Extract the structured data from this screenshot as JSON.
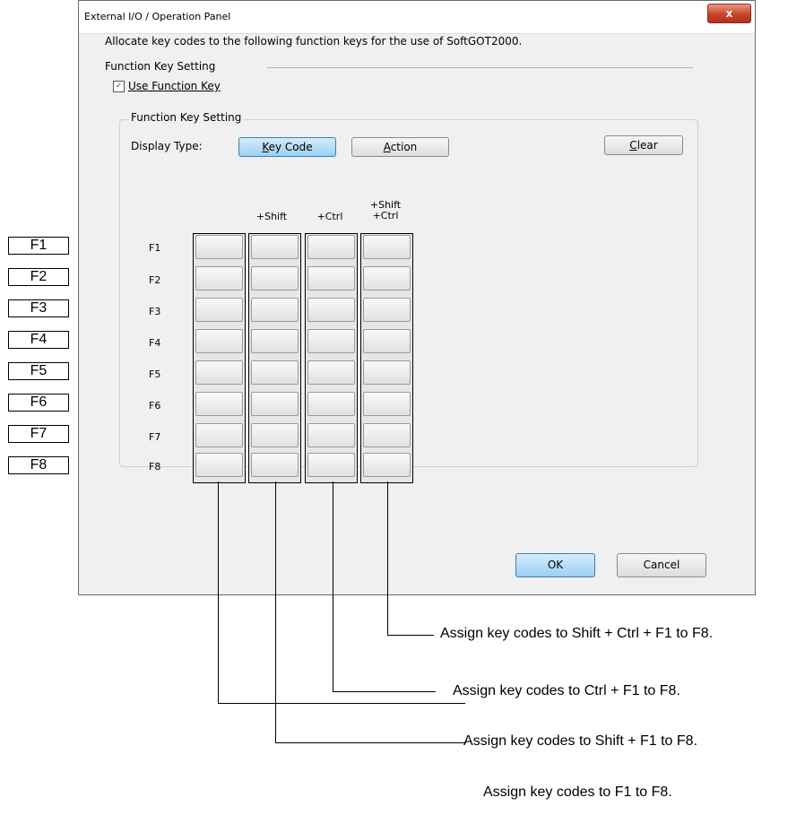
{
  "dialog": {
    "title": "External I/O / Operation Panel",
    "close_glyph": "x",
    "instruction": "Allocate key codes to the following function keys for the use of SoftGOT2000.",
    "section_label": "Function Key Setting",
    "use_function_key": {
      "label": "Use Function Key",
      "checked": true,
      "check_glyph": "✓"
    },
    "group_label": "Function Key Setting",
    "display_type_label": "Display Type:",
    "buttons": {
      "key_code": {
        "mnemonic": "K",
        "rest": "ey Code"
      },
      "action": {
        "mnemonic": "A",
        "rest": "ction"
      },
      "clear": {
        "mnemonic": "C",
        "rest": "lear"
      },
      "ok": "OK",
      "cancel": "Cancel"
    },
    "columns": [
      "",
      "+Shift",
      "+Ctrl",
      "+Shift\n+Ctrl"
    ],
    "rows": [
      "F1",
      "F2",
      "F3",
      "F4",
      "F5",
      "F6",
      "F7",
      "F8"
    ]
  },
  "external_keys": [
    "F1",
    "F2",
    "F3",
    "F4",
    "F5",
    "F6",
    "F7",
    "F8"
  ],
  "callouts": [
    "Assign key codes to Shift + Ctrl + F1 to F8.",
    "Assign key codes to Ctrl + F1 to F8.",
    "Assign key codes to Shift + F1 to F8.",
    "Assign key codes to F1 to F8."
  ],
  "colors": {
    "selected_button": "#9ccff3",
    "dialog_bg": "#f0f0f0",
    "close_button": "#c8442a"
  }
}
